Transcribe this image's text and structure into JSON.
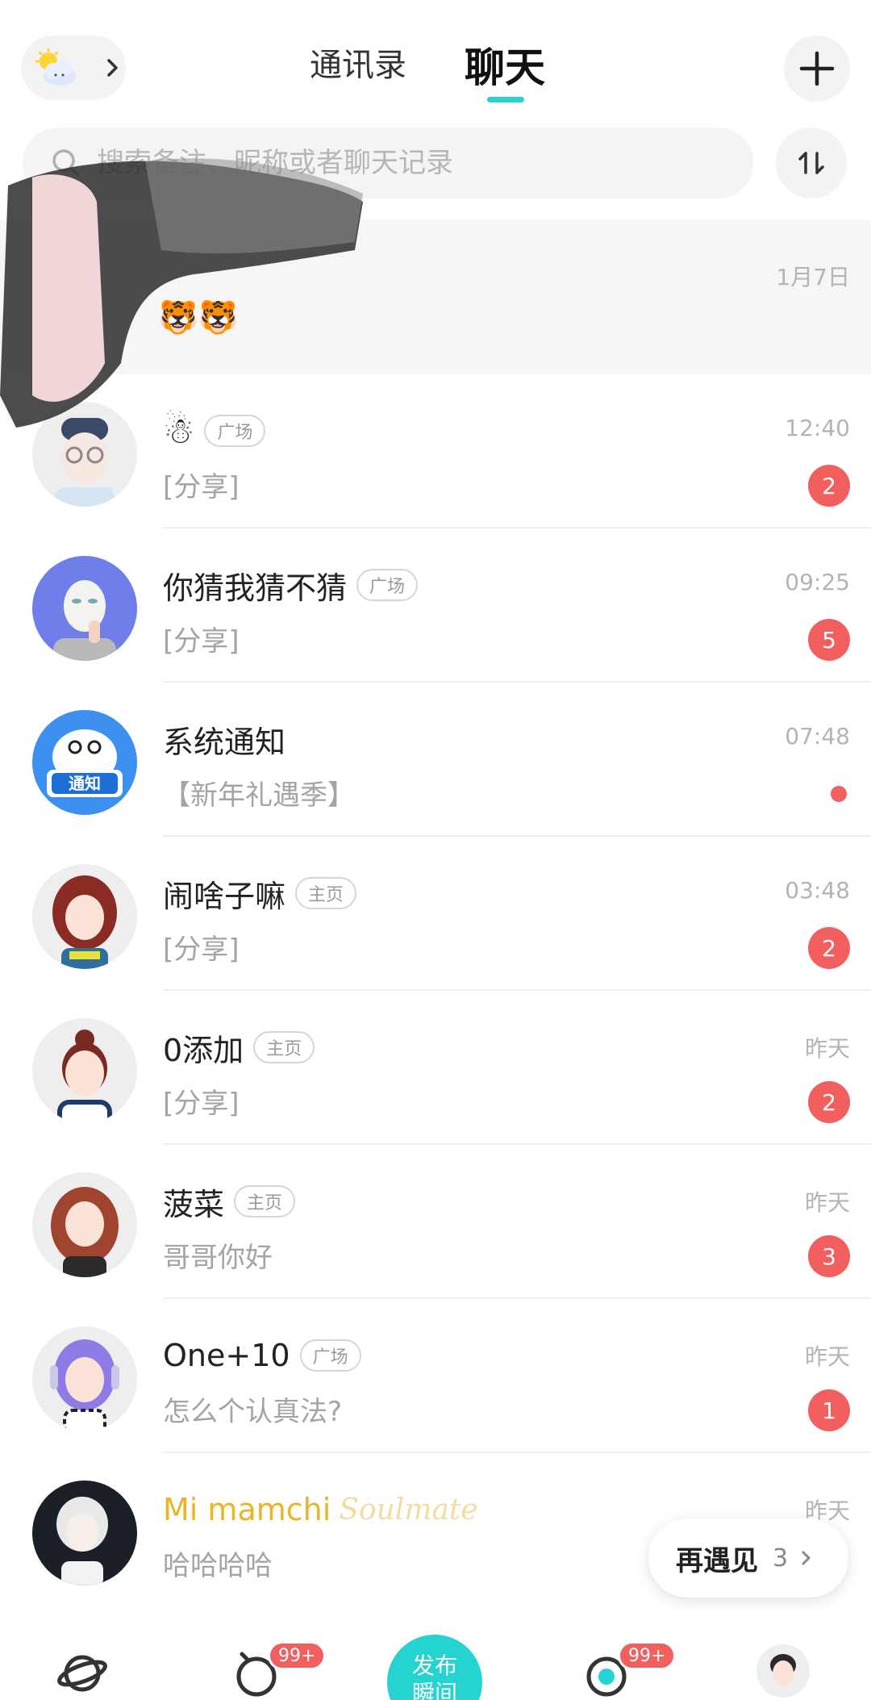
{
  "header": {
    "tab_contacts": "通讯录",
    "tab_chat": "聊天",
    "accent_color": "#25d4d0"
  },
  "search": {
    "placeholder": "搜索备注、昵称或者聊天记录"
  },
  "pinned": {
    "time": "1月7日",
    "preview": "🐯🐯"
  },
  "chats": [
    {
      "name": "",
      "emoji": "☃",
      "tag": "广场",
      "message": "[分享]",
      "time": "12:40",
      "badge": "2"
    },
    {
      "name": "你猜我猜不猜",
      "tag": "广场",
      "message": "[分享]",
      "time": "09:25",
      "badge": "5"
    },
    {
      "name": "系统通知",
      "tag": "",
      "message": "【新年礼遇季】",
      "time": "07:48",
      "dot": true,
      "avatar_text": "通知"
    },
    {
      "name": "闹啥子嘛",
      "tag": "主页",
      "message": "[分享]",
      "time": "03:48",
      "badge": "2"
    },
    {
      "name": "0添加",
      "tag": "主页",
      "message": "[分享]",
      "time": "昨天",
      "badge": "2"
    },
    {
      "name": "菠菜",
      "tag": "主页",
      "message": "哥哥你好",
      "time": "昨天",
      "badge": "3"
    },
    {
      "name": "One+10",
      "tag": "广场",
      "message": "怎么个认真法?",
      "time": "昨天",
      "badge": "1"
    },
    {
      "name": "Mi mamchi",
      "tag": "",
      "soul_label": "Soulmate",
      "message": "哈哈哈哈",
      "time": "昨天"
    }
  ],
  "meet_again": {
    "label": "再遇见",
    "count": "3"
  },
  "bottom_nav": {
    "planet_badge": "",
    "alarm_badge": "99+",
    "publish_label_line1": "发布",
    "publish_label_line2": "瞬间",
    "chat_badge": "99+"
  }
}
